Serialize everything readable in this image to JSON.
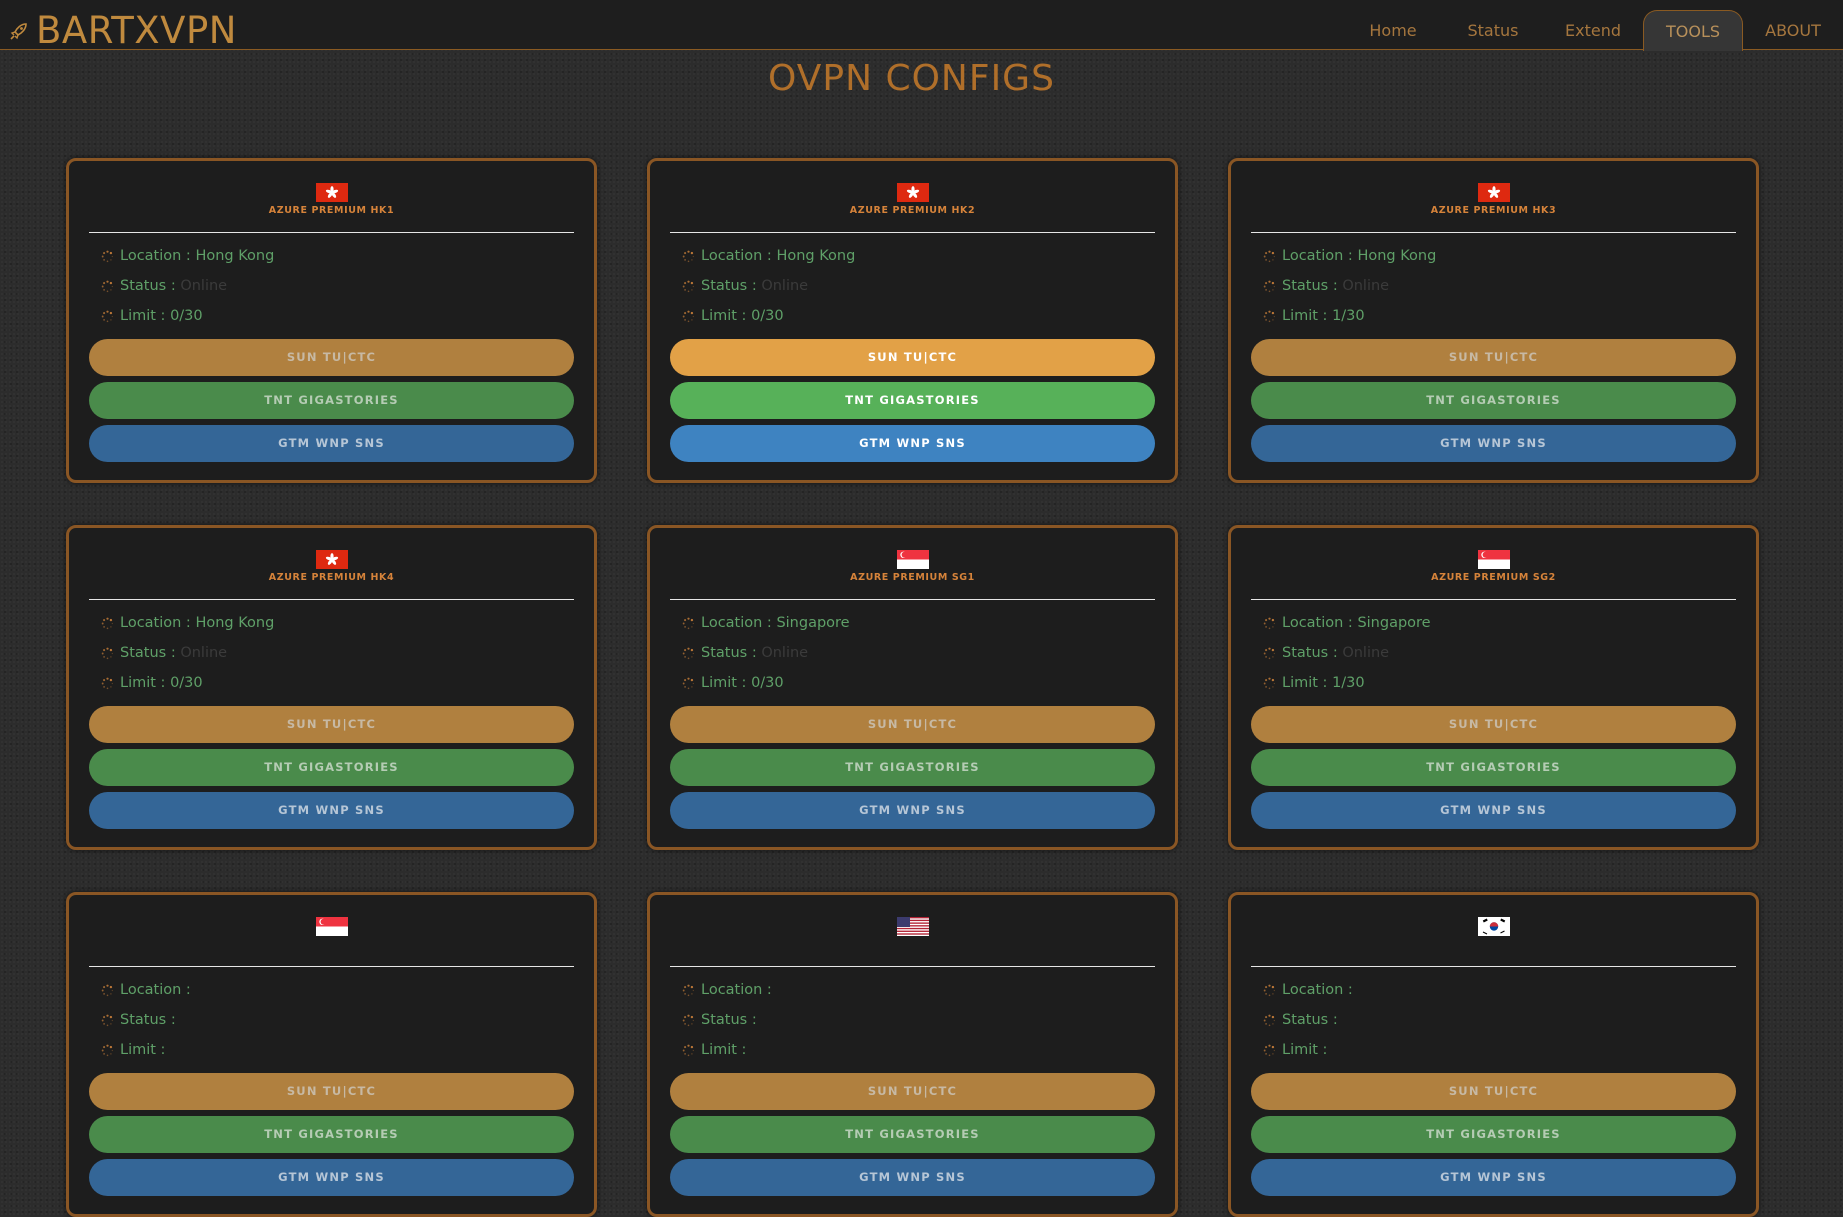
{
  "navbar": {
    "brand": "BARTXVPN",
    "brand_icon": "rocket-icon",
    "items": [
      "Home",
      "Status",
      "Extend",
      "TOOLS",
      "ABOUT"
    ],
    "active": "TOOLS"
  },
  "page": {
    "title": "OVPN CONFIGS"
  },
  "colors": {
    "accent": "#b06f2a",
    "card_border": "#8a5624",
    "info_text": "#5fa068"
  },
  "buttons": {
    "sun": "SUN TU|CTC",
    "tnt": "TNT GIGASTORIES",
    "gtm": "GTM WNP SNS"
  },
  "labels": {
    "location": "Location : ",
    "status": "Status : ",
    "limit": "Limit : "
  },
  "servers": [
    {
      "name": "AZURE PREMIUM HK1",
      "flag": "hong-kong-flag-icon",
      "location": "Hong Kong",
      "status": "Online",
      "limit": "0/30"
    },
    {
      "name": "AZURE PREMIUM HK2",
      "flag": "hong-kong-flag-icon",
      "location": "Hong Kong",
      "status": "Online",
      "limit": "0/30"
    },
    {
      "name": "AZURE PREMIUM HK3",
      "flag": "hong-kong-flag-icon",
      "location": "Hong Kong",
      "status": "Online",
      "limit": "1/30"
    },
    {
      "name": "AZURE PREMIUM HK4",
      "flag": "hong-kong-flag-icon",
      "location": "Hong Kong",
      "status": "Online",
      "limit": "0/30"
    },
    {
      "name": "AZURE PREMIUM SG1",
      "flag": "singapore-flag-icon",
      "location": "Singapore",
      "status": "Online",
      "limit": "0/30"
    },
    {
      "name": "AZURE PREMIUM SG2",
      "flag": "singapore-flag-icon",
      "location": "Singapore",
      "status": "Online",
      "limit": "1/30"
    },
    {
      "name": "",
      "flag": "singapore-flag-icon",
      "location": "",
      "status": "",
      "limit": ""
    },
    {
      "name": "",
      "flag": "usa-flag-icon",
      "location": "",
      "status": "",
      "limit": ""
    },
    {
      "name": "",
      "flag": "south-korea-flag-icon",
      "location": "",
      "status": "",
      "limit": ""
    }
  ]
}
